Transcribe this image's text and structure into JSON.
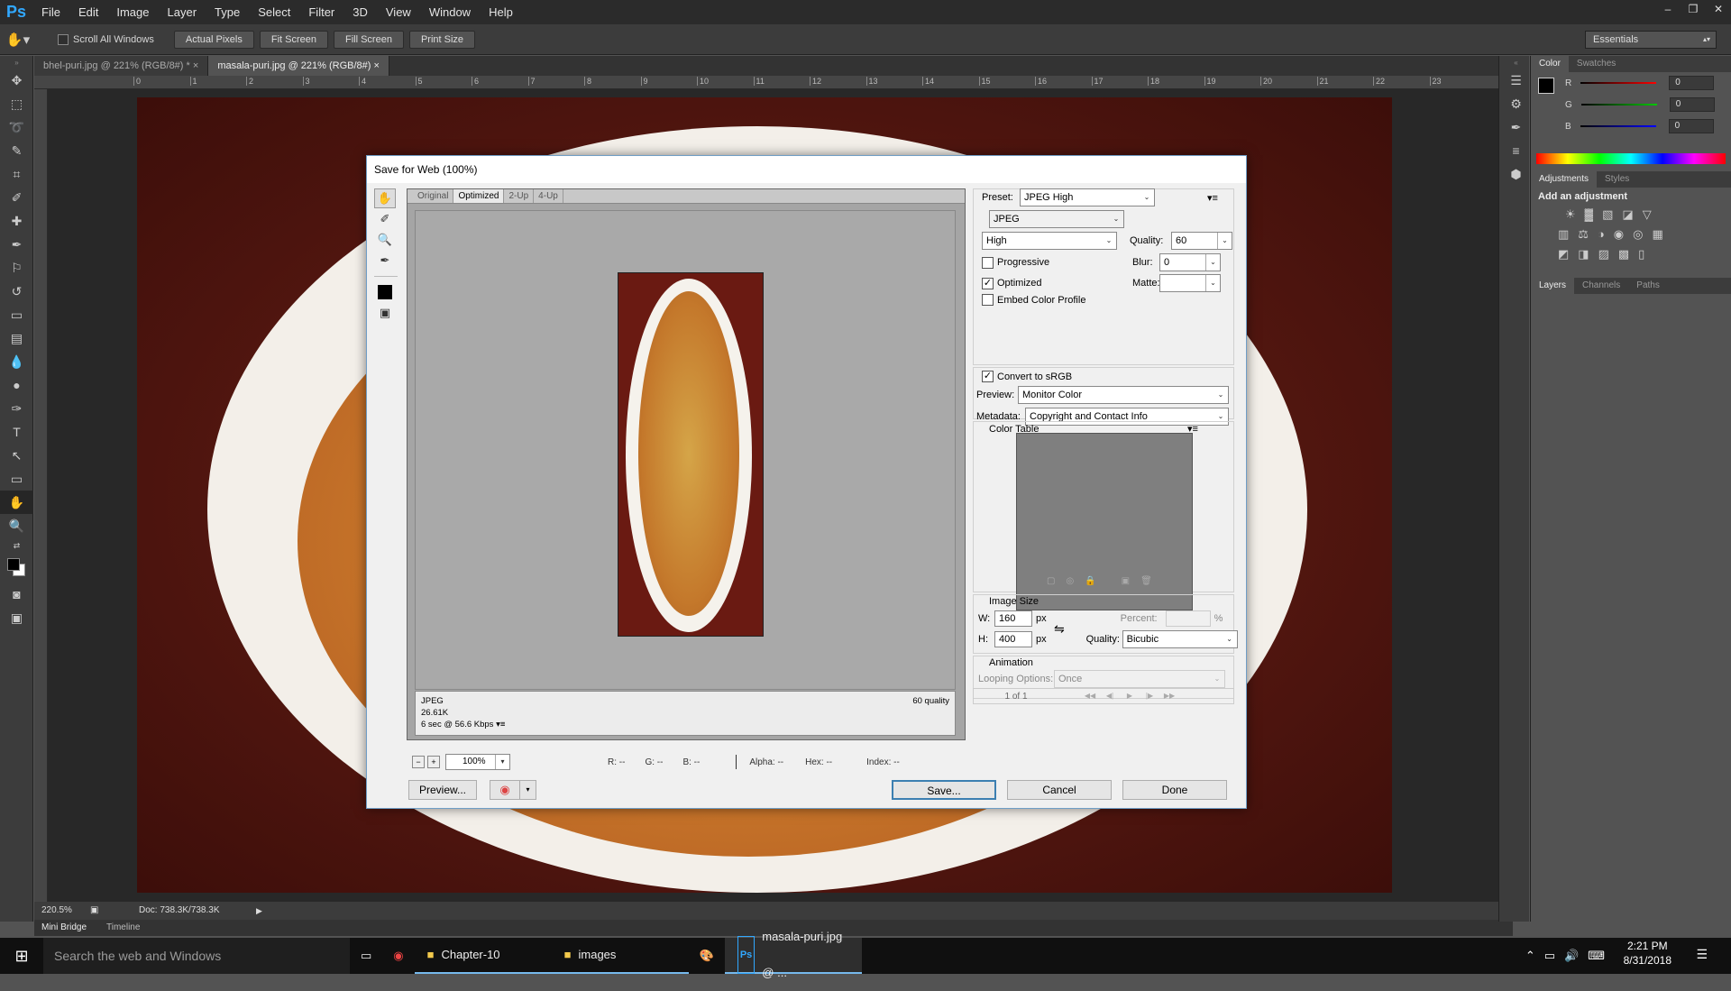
{
  "app": {
    "logo": "Ps"
  },
  "menu": [
    "File",
    "Edit",
    "Image",
    "Layer",
    "Type",
    "Select",
    "Filter",
    "3D",
    "View",
    "Window",
    "Help"
  ],
  "options_bar": {
    "scroll_all": "Scroll All Windows",
    "buttons": [
      "Actual Pixels",
      "Fit Screen",
      "Fill Screen",
      "Print Size"
    ],
    "workspace": "Essentials"
  },
  "doc_tabs": [
    {
      "label": "bhel-puri.jpg @ 221% (RGB/8#) *"
    },
    {
      "label": "masala-puri.jpg @ 221% (RGB/8#)"
    }
  ],
  "ruler_ticks": [
    "0",
    "1",
    "2",
    "3",
    "4",
    "5",
    "6",
    "7",
    "8",
    "9",
    "10",
    "11",
    "12",
    "13",
    "14",
    "15",
    "16",
    "17",
    "18",
    "19",
    "20",
    "21",
    "22",
    "23"
  ],
  "status": {
    "zoom": "220.5%",
    "doc": "Doc: 738.3K/738.3K"
  },
  "bottom_tabs": [
    "Mini Bridge",
    "Timeline"
  ],
  "color_panel": {
    "tabs": [
      "Color",
      "Swatches"
    ],
    "channels": [
      {
        "label": "R",
        "value": "0",
        "color": "#ff0000"
      },
      {
        "label": "G",
        "value": "0",
        "color": "#00c800"
      },
      {
        "label": "B",
        "value": "0",
        "color": "#0000ff"
      }
    ]
  },
  "adjustments_panel": {
    "tabs": [
      "Adjustments",
      "Styles"
    ],
    "hint": "Add an adjustment"
  },
  "layers_panel": {
    "tabs": [
      "Layers",
      "Channels",
      "Paths"
    ]
  },
  "dialog": {
    "title": "Save for Web (100%)",
    "view_tabs": [
      "Original",
      "Optimized",
      "2-Up",
      "4-Up"
    ],
    "info": {
      "format": "JPEG",
      "size": "26.61K",
      "time": "6 sec @ 56.6 Kbps",
      "quality_note": "60 quality"
    },
    "zoom": "100%",
    "readouts": [
      "R: --",
      "G: --",
      "B: --",
      "Alpha: --",
      "Hex: --",
      "Index: --"
    ],
    "preview_btn": "Preview...",
    "save_btn": "Save...",
    "cancel_btn": "Cancel",
    "done_btn": "Done",
    "settings": {
      "preset_label": "Preset:",
      "preset": "JPEG High",
      "format": "JPEG",
      "compression": "High",
      "quality_label": "Quality:",
      "quality": "60",
      "progressive": "Progressive",
      "blur_label": "Blur:",
      "blur": "0",
      "optimized": "Optimized",
      "matte_label": "Matte:",
      "embed_profile": "Embed Color Profile",
      "convert_srgb": "Convert to sRGB",
      "preview_label": "Preview:",
      "preview": "Monitor Color",
      "metadata_label": "Metadata:",
      "metadata": "Copyright and Contact Info",
      "color_table": "Color Table",
      "image_size": "Image Size",
      "w_label": "W:",
      "w": "160",
      "h_label": "H:",
      "h": "400",
      "px": "px",
      "percent_label": "Percent:",
      "percent_sign": "%",
      "resample_quality_label": "Quality:",
      "resample": "Bicubic",
      "animation": "Animation",
      "looping_label": "Looping Options:",
      "looping": "Once",
      "frame": "1 of 1"
    }
  },
  "taskbar": {
    "search": "Search the web and Windows",
    "items": [
      "Chapter-10",
      "images",
      "masala-puri.jpg @ ..."
    ],
    "time": "2:21 PM",
    "date": "8/31/2018"
  }
}
